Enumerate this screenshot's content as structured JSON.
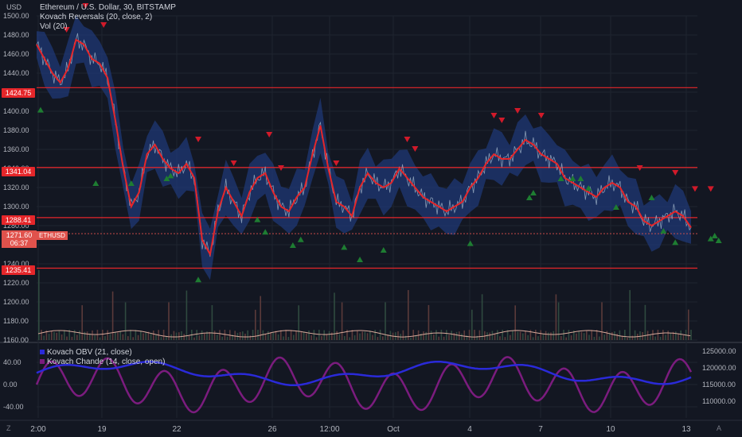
{
  "currency_label": "USD",
  "legend": {
    "main_title": "Ethereum / U.S. Dollar, 30, BITSTAMP",
    "indicator_1": "Kovach Reversals (20, close, 2)",
    "indicator_2": "Vol (20)",
    "sub_indicator_1": "Kovach OBV (21, close)",
    "sub_indicator_2": "Kovach Chande (14, close, open)"
  },
  "price_tag": {
    "price": "1271.60",
    "time": "06:37",
    "symbol": "ETHUSD"
  },
  "corner_buttons": {
    "left": "Z",
    "right": "A"
  },
  "colors": {
    "background": "#131722",
    "grid": "#1f2430",
    "price_line": "#e5262a",
    "band": "#1f3b7a",
    "level_line": "#e5262a",
    "up_marker": "#1e7d32",
    "down_marker": "#d11a2a",
    "obv": "#2a2ad9",
    "chande": "#7b1c7e",
    "volume": "#d8a99a"
  },
  "chart_data": [
    {
      "type": "line",
      "series_description": "ETHUSD 30-minute price",
      "x_ticks": [
        "2:00",
        "19",
        "22",
        "26",
        "12:00",
        "Oct",
        "4",
        "7",
        "10",
        "13"
      ],
      "y_ticks": [
        "1160.00",
        "1180.00",
        "1200.00",
        "1220.00",
        "1240.00",
        "1260.00",
        "1280.00",
        "1300.00",
        "1320.00",
        "1340.00",
        "1360.00",
        "1380.00",
        "1400.00",
        "1420.00",
        "1440.00",
        "1460.00",
        "1480.00",
        "1500.00"
      ],
      "ylim": [
        1160,
        1500
      ],
      "levels": [
        1424.75,
        1341.04,
        1288.41,
        1235.41
      ],
      "level_labels": [
        "1424.75",
        "1341.04",
        "1288.41",
        "1235.41"
      ],
      "x": [
        0,
        10,
        20,
        30,
        40,
        50,
        60,
        70,
        80,
        90,
        100,
        110,
        120,
        130,
        140,
        150,
        160,
        170,
        180,
        190,
        200,
        210,
        220,
        230,
        240,
        250,
        260,
        270,
        280,
        290,
        300,
        310,
        320,
        330,
        340,
        350,
        360,
        370,
        380,
        390,
        400,
        410,
        420,
        430,
        440,
        450,
        460,
        470,
        480,
        490,
        500,
        510,
        520,
        530,
        540,
        550,
        560,
        570,
        580,
        590,
        600,
        610,
        620,
        630,
        640,
        650,
        660,
        670,
        680,
        690,
        700,
        710,
        720,
        730,
        740,
        750,
        760,
        770,
        780,
        790,
        800,
        810,
        820,
        830
      ],
      "close": [
        1470,
        1455,
        1440,
        1430,
        1445,
        1475,
        1470,
        1455,
        1450,
        1435,
        1390,
        1340,
        1300,
        1315,
        1355,
        1365,
        1350,
        1340,
        1335,
        1345,
        1330,
        1265,
        1250,
        1295,
        1320,
        1305,
        1290,
        1315,
        1330,
        1335,
        1315,
        1300,
        1295,
        1310,
        1320,
        1355,
        1385,
        1340,
        1305,
        1300,
        1290,
        1320,
        1335,
        1325,
        1320,
        1325,
        1340,
        1330,
        1320,
        1310,
        1305,
        1300,
        1295,
        1300,
        1305,
        1320,
        1330,
        1345,
        1355,
        1350,
        1350,
        1360,
        1370,
        1365,
        1355,
        1350,
        1345,
        1330,
        1325,
        1320,
        1315,
        1310,
        1320,
        1325,
        1320,
        1305,
        1300,
        1285,
        1280,
        1285,
        1290,
        1295,
        1290,
        1278
      ],
      "up_markers_x": [
        5,
        75,
        120,
        165,
        170,
        205,
        280,
        290,
        325,
        335,
        390,
        410,
        440,
        550,
        625,
        630,
        665,
        680,
        690,
        700,
        735,
        780,
        795,
        810,
        855,
        860,
        865
      ],
      "up_markers_y": [
        1402,
        1325,
        1325,
        1330,
        1333,
        1224,
        1287,
        1274,
        1260,
        1266,
        1258,
        1245,
        1255,
        1262,
        1310,
        1315,
        1330,
        1330,
        1330,
        1320,
        1300,
        1310,
        1275,
        1263,
        1267,
        1270,
        1265
      ],
      "down_markers_x": [
        38,
        62,
        85,
        205,
        250,
        295,
        310,
        380,
        470,
        480,
        580,
        590,
        610,
        640,
        765,
        810,
        835,
        855
      ]
    },
    {
      "type": "line",
      "series_description": "Volume with moving average",
      "ylim": [
        0,
        100
      ]
    },
    {
      "type": "line",
      "series": [
        {
          "name": "Kovach OBV (21, close)",
          "axis": "right",
          "ylim": [
            105000,
            125000
          ]
        },
        {
          "name": "Kovach Chande (14, close, open)",
          "axis": "left",
          "ylim": [
            -60,
            60
          ]
        }
      ],
      "left_ticks": [
        "40.00",
        "0.00",
        "-40.00"
      ],
      "right_ticks": [
        "125000.00",
        "120000.00",
        "115000.00",
        "110000.00"
      ]
    }
  ]
}
